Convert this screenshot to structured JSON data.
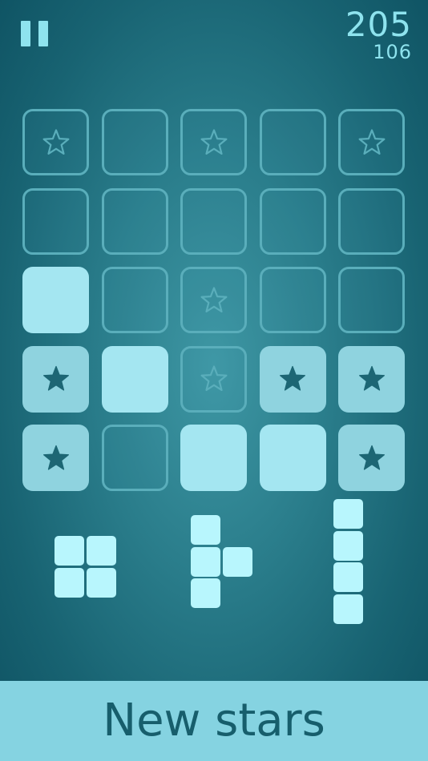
{
  "score": {
    "current": "205",
    "best": "106"
  },
  "board": {
    "rows": [
      [
        {
          "state": "empty",
          "star": true
        },
        {
          "state": "empty",
          "star": false
        },
        {
          "state": "empty",
          "star": true
        },
        {
          "state": "empty",
          "star": false
        },
        {
          "state": "empty",
          "star": true
        }
      ],
      [
        {
          "state": "empty",
          "star": false
        },
        {
          "state": "empty",
          "star": false
        },
        {
          "state": "empty",
          "star": false
        },
        {
          "state": "empty",
          "star": false
        },
        {
          "state": "empty",
          "star": false
        }
      ],
      [
        {
          "state": "filled",
          "star": false
        },
        {
          "state": "empty",
          "star": false
        },
        {
          "state": "empty",
          "star": true
        },
        {
          "state": "empty",
          "star": false
        },
        {
          "state": "empty",
          "star": false
        }
      ],
      [
        {
          "state": "filled",
          "star": true
        },
        {
          "state": "filled",
          "star": false
        },
        {
          "state": "empty",
          "star": true
        },
        {
          "state": "filled",
          "star": true
        },
        {
          "state": "filled",
          "star": true
        }
      ],
      [
        {
          "state": "filled",
          "star": true
        },
        {
          "state": "empty",
          "star": false
        },
        {
          "state": "filled",
          "star": false
        },
        {
          "state": "filled",
          "star": false
        },
        {
          "state": "filled",
          "star": true
        }
      ]
    ]
  },
  "pieces": [
    {
      "name": "square-piece",
      "cells": [
        [
          0,
          0
        ],
        [
          1,
          0
        ],
        [
          0,
          1
        ],
        [
          1,
          1
        ]
      ]
    },
    {
      "name": "t-piece",
      "cells": [
        [
          0,
          0
        ],
        [
          0,
          1
        ],
        [
          1,
          1
        ],
        [
          0,
          2
        ]
      ]
    },
    {
      "name": "i-piece",
      "cells": [
        [
          0,
          0
        ],
        [
          0,
          1
        ],
        [
          0,
          2
        ],
        [
          0,
          3
        ]
      ]
    }
  ],
  "footer": {
    "label": "New stars"
  },
  "colors": {
    "accent": "#8ee3ee",
    "filled": "#a4e6f1",
    "empty_border": "#5aaebb",
    "star": "#1d6674",
    "star_outline": "#5aaebb",
    "footer": "#85d3e1",
    "footer_text": "#175e6c"
  },
  "icons": {
    "pause": "pause-icon",
    "star": "star-icon"
  }
}
